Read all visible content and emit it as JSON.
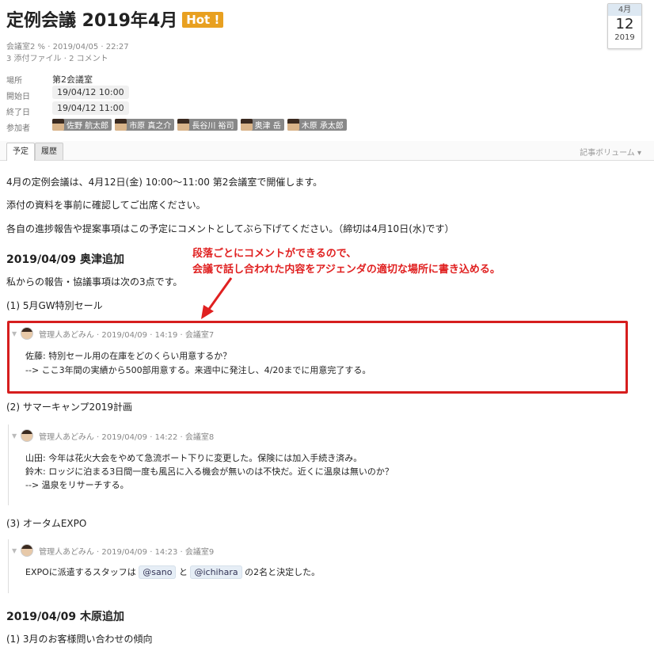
{
  "header": {
    "title": "定例会議 2019年4月",
    "hot_badge": "Hot !",
    "meta_line1": "会議室2 % · 2019/04/05 · 22:27",
    "meta_line2": "3 添付ファイル · 2 コメント"
  },
  "calendar": {
    "month": "4月",
    "day": "12",
    "year": "2019"
  },
  "props": {
    "place_label": "場所",
    "place_value": "第2会議室",
    "start_label": "開始日",
    "start_value": "19/04/12 10:00",
    "end_label": "終了日",
    "end_value": "19/04/12 11:00",
    "attendees_label": "参加者",
    "attendees": [
      "佐野 航太郎",
      "市原 真之介",
      "長谷川 裕司",
      "奥津 岳",
      "木原 承太郎"
    ]
  },
  "tabs": {
    "schedule": "予定",
    "history": "履歴",
    "volume": "記事ボリューム"
  },
  "body": {
    "p1": "4月の定例会議は、4月12日(金) 10:00〜11:00 第2会議室で開催します。",
    "p2": "添付の資料を事前に確認してご出席ください。",
    "p3": "各自の進捗報告や提案事項はこの予定にコメントとしてぶら下げてください。（締切は4月10日(水)です）",
    "h1": "2019/04/09 奥津追加",
    "p4": "私からの報告・協議事項は次の3点です。",
    "item1": "(1) 5月GW特別セール",
    "item2": "(2) サマーキャンプ2019計画",
    "item3": "(3) オータムEXPO",
    "h2": "2019/04/09 木原追加",
    "item4": "(1) 3月のお客様問い合わせの傾向"
  },
  "annotation": {
    "line1": "段落ごとにコメントができるので、",
    "line2": "会議で話し合われた内容をアジェンダの適切な場所に書き込める。"
  },
  "comments": [
    {
      "header": "管理人あどみん · 2019/04/09 · 14:19 · 会議室7",
      "lines": [
        "佐藤: 特別セール用の在庫をどのくらい用意するか？",
        "--> ここ3年間の実績から500部用意する。来週中に発注し、4/20までに用意完了する。"
      ]
    },
    {
      "header": "管理人あどみん · 2019/04/09 · 14:22 · 会議室8",
      "lines": [
        "山田: 今年は花火大会をやめて急流ボート下りに変更した。保険には加入手続き済み。",
        "鈴木: ロッジに泊まる3日間一度も風呂に入る機会が無いのは不快だ。近くに温泉は無いのか？",
        "--> 温泉をリサーチする。"
      ]
    },
    {
      "header": "管理人あどみん · 2019/04/09 · 14:23 · 会議室9",
      "text_before": "EXPOに派遣するスタッフは",
      "mention1": "@sano",
      "text_mid": "と",
      "mention2": "@ichihara",
      "text_after": "の2名と決定した。"
    }
  ],
  "colors": {
    "hot": "#e8a020",
    "annotation": "#e02020",
    "highlight_box": "#d61e1e"
  }
}
